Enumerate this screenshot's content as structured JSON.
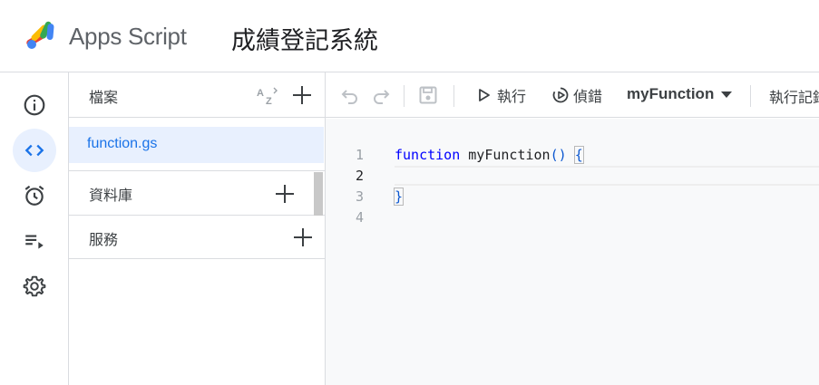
{
  "header": {
    "app_name": "Apps Script",
    "project_title": "成績登記系統"
  },
  "rail": {
    "items": [
      {
        "name": "overview",
        "icon": "info-icon",
        "active": false
      },
      {
        "name": "editor",
        "icon": "code-icon",
        "active": true
      },
      {
        "name": "triggers",
        "icon": "alarm-clock-icon",
        "active": false
      },
      {
        "name": "executions",
        "icon": "list-play-icon",
        "active": false
      },
      {
        "name": "settings",
        "icon": "gear-icon",
        "active": false
      }
    ]
  },
  "files": {
    "header_label": "檔案",
    "items": [
      {
        "label": "function.gs",
        "selected": true
      }
    ],
    "libraries_label": "資料庫",
    "services_label": "服務"
  },
  "toolbar": {
    "run_label": "執行",
    "debug_label": "偵錯",
    "function_select": "myFunction",
    "execution_log_label": "執行記錄"
  },
  "editor": {
    "line_numbers": [
      "1",
      "2",
      "3",
      "4"
    ],
    "current_line": 2,
    "code": {
      "line1_keyword": "function",
      "line1_name": " myFunction",
      "line1_parens": "()",
      "line1_brace": "{",
      "line3_brace": "}"
    }
  },
  "colors": {
    "accent": "#1a73e8",
    "active_bg": "#e8f0fe",
    "border": "#dadce0",
    "editor_bg": "#f8f9fa"
  }
}
